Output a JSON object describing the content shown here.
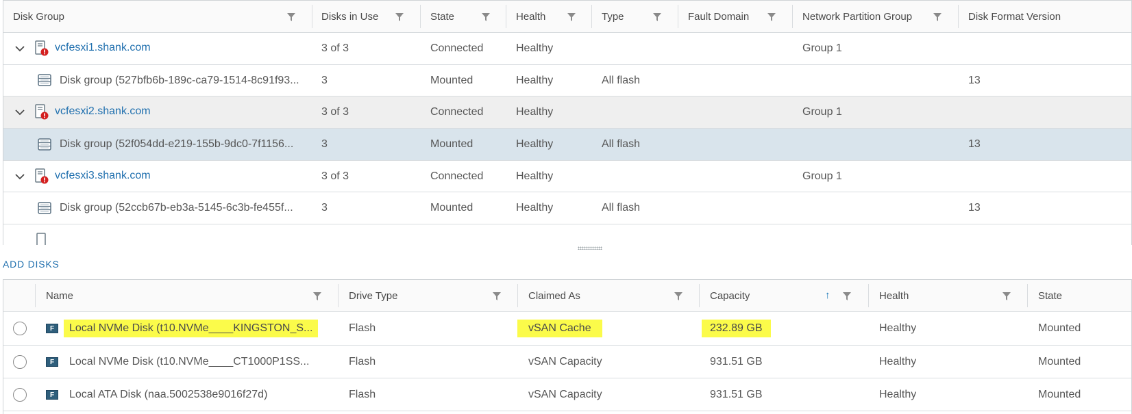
{
  "disk_groups_table": {
    "columns": [
      {
        "label": "Disk Group"
      },
      {
        "label": "Disks in Use"
      },
      {
        "label": "State"
      },
      {
        "label": "Health"
      },
      {
        "label": "Type"
      },
      {
        "label": "Fault Domain"
      },
      {
        "label": "Network Partition Group"
      },
      {
        "label": "Disk Format Version"
      }
    ],
    "rows": [
      {
        "kind": "host",
        "name": "vcfesxi1.shank.com",
        "disks_in_use": "3 of 3",
        "state": "Connected",
        "health": "Healthy",
        "type": "",
        "fault_domain": "",
        "network_partition_group": "Group 1",
        "disk_format_version": ""
      },
      {
        "kind": "disk_group",
        "name": "Disk group (527bfb6b-189c-ca79-1514-8c91f93...",
        "disks_in_use": "3",
        "state": "Mounted",
        "health": "Healthy",
        "type": "All flash",
        "fault_domain": "",
        "network_partition_group": "",
        "disk_format_version": "13"
      },
      {
        "kind": "host",
        "name": "vcfesxi2.shank.com",
        "disks_in_use": "3 of 3",
        "state": "Connected",
        "health": "Healthy",
        "type": "",
        "fault_domain": "",
        "network_partition_group": "Group 1",
        "disk_format_version": ""
      },
      {
        "kind": "disk_group",
        "name": "Disk group (52f054dd-e219-155b-9dc0-7f1156...",
        "disks_in_use": "3",
        "state": "Mounted",
        "health": "Healthy",
        "type": "All flash",
        "fault_domain": "",
        "network_partition_group": "",
        "disk_format_version": "13",
        "selected": true
      },
      {
        "kind": "host",
        "name": "vcfesxi3.shank.com",
        "disks_in_use": "3 of 3",
        "state": "Connected",
        "health": "Healthy",
        "type": "",
        "fault_domain": "",
        "network_partition_group": "Group 1",
        "disk_format_version": ""
      },
      {
        "kind": "disk_group",
        "name": "Disk group (52ccb67b-eb3a-5145-6c3b-fe455f...",
        "disks_in_use": "3",
        "state": "Mounted",
        "health": "Healthy",
        "type": "All flash",
        "fault_domain": "",
        "network_partition_group": "",
        "disk_format_version": "13"
      }
    ]
  },
  "add_disks_label": "ADD DISKS",
  "disks_table": {
    "columns": [
      {
        "label": "Name"
      },
      {
        "label": "Drive Type"
      },
      {
        "label": "Claimed As"
      },
      {
        "label": "Capacity",
        "sorted": "ascending"
      },
      {
        "label": "Health"
      },
      {
        "label": "State"
      }
    ],
    "rows": [
      {
        "badge": "F",
        "name": "Local NVMe Disk (t10.NVMe____KINGSTON_S...",
        "drive_type": "Flash",
        "claimed_as": "vSAN Cache",
        "capacity": "232.89 GB",
        "health": "Healthy",
        "state": "Mounted",
        "highlighted": true
      },
      {
        "badge": "F",
        "name": "Local NVMe Disk (t10.NVMe____CT1000P1SS...",
        "drive_type": "Flash",
        "claimed_as": "vSAN Capacity",
        "capacity": "931.51 GB",
        "health": "Healthy",
        "state": "Mounted"
      },
      {
        "badge": "F",
        "name": "Local ATA Disk (naa.5002538e9016f27d)",
        "drive_type": "Flash",
        "claimed_as": "vSAN Capacity",
        "capacity": "931.51 GB",
        "health": "Healthy",
        "state": "Mounted"
      }
    ]
  },
  "colors": {
    "link": "#1f6fae",
    "highlight": "#fbfb4a",
    "selected_row": "#d9e4ec",
    "host_band": "#efefef",
    "alert": "#d42020"
  },
  "icons": {
    "filter": "funnel-icon",
    "sort": "arrow-up-icon",
    "host": "server-alert-icon",
    "disk_group": "disk-stack-icon",
    "expand": "chevron-down-icon",
    "flash_disk": "flash-disk-badge-icon"
  }
}
